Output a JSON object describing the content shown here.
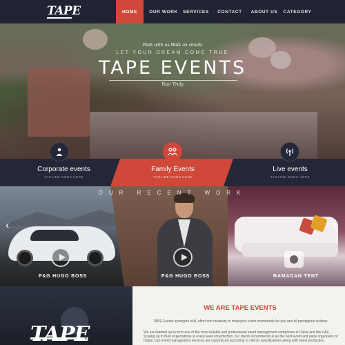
{
  "brand": {
    "logo": "TAPE"
  },
  "nav": {
    "items": [
      {
        "label": "HOME",
        "active": true
      },
      {
        "label": "OUR WORK",
        "active": false
      },
      {
        "label": "SERVICES",
        "active": false
      },
      {
        "label": "CONTACT",
        "active": false
      },
      {
        "label": "ABOUT US",
        "active": false
      },
      {
        "label": "CATEGORY",
        "active": false
      }
    ]
  },
  "hero": {
    "tagline": "Walk with us Walk on clouds",
    "subtitle": "LET YOUR DREAM COME TRUE",
    "title": "TAPE EVENTS",
    "byline": "Your Truly"
  },
  "services": [
    {
      "title": "Corporate events",
      "tagline": "TAGLINE GOES HERE",
      "icon": "presenter-icon",
      "active": false
    },
    {
      "title": "Family Events",
      "tagline": "TAGLINE GOES HERE",
      "icon": "family-icon",
      "active": true
    },
    {
      "title": "Live events",
      "tagline": "TAGLINE GOES HERE",
      "icon": "broadcast-icon",
      "active": false
    }
  ],
  "recent_work": {
    "title": "OUR RECENT WORK",
    "items": [
      {
        "caption": "P&G HUGO BOSS",
        "media": "video"
      },
      {
        "caption": "P&G HUGO BOSS",
        "media": "video"
      },
      {
        "caption": "RAMADAN TENT",
        "media": "photo"
      }
    ],
    "prev_icon": "‹",
    "next_icon": "›"
  },
  "about": {
    "logo": "TAPE",
    "title": "WE ARE TAPE EVENTS",
    "paragraph1": "TAPE Events synergize skill, effort and creativity to makeyour event memorable for you and all prestigious invitees.",
    "paragraph2": "We are teamed up to form one of the most reliable and professional event management companies in Dubai and the UAE. Scaling up to their expectations at every level of perfection, our clients recommend us as the best event and party organisers of Dubai. Our event management services are customized according to clients’ specifications along with latest production."
  },
  "colors": {
    "accent": "#d0483a",
    "navbar": "#1f2333",
    "band": "#232738",
    "about_bg": "#f4f2ef"
  }
}
